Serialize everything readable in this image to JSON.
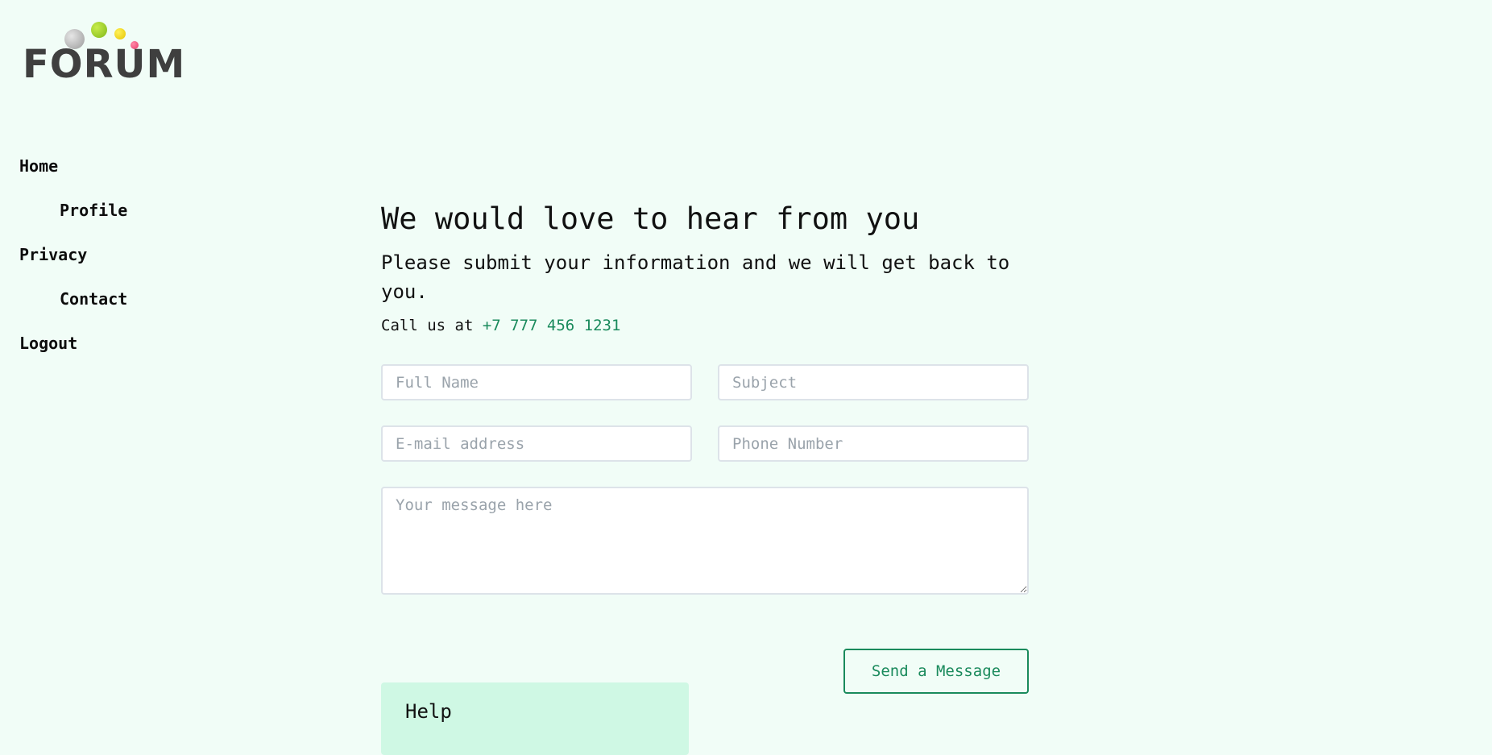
{
  "logo": {
    "text": "FORUM"
  },
  "nav": {
    "items": [
      {
        "label": "Home"
      },
      {
        "label": "Profile"
      },
      {
        "label": "Privacy"
      },
      {
        "label": "Contact"
      },
      {
        "label": "Logout"
      }
    ]
  },
  "main": {
    "title": "We would love to hear from you",
    "subtitle": "Please submit your information and we will get back to you.",
    "call_prefix": "Call us at ",
    "phone": "+7 777 456 1231"
  },
  "form": {
    "full_name_placeholder": "Full Name",
    "subject_placeholder": "Subject",
    "email_placeholder": "E-mail address",
    "phone_placeholder": "Phone Number",
    "message_placeholder": "Your message here",
    "send_label": "Send a Message"
  },
  "help": {
    "title": "Help"
  },
  "colors": {
    "background": "#f1fdf7",
    "accent": "#1a8a5c",
    "help_panel": "#cff8e4"
  }
}
